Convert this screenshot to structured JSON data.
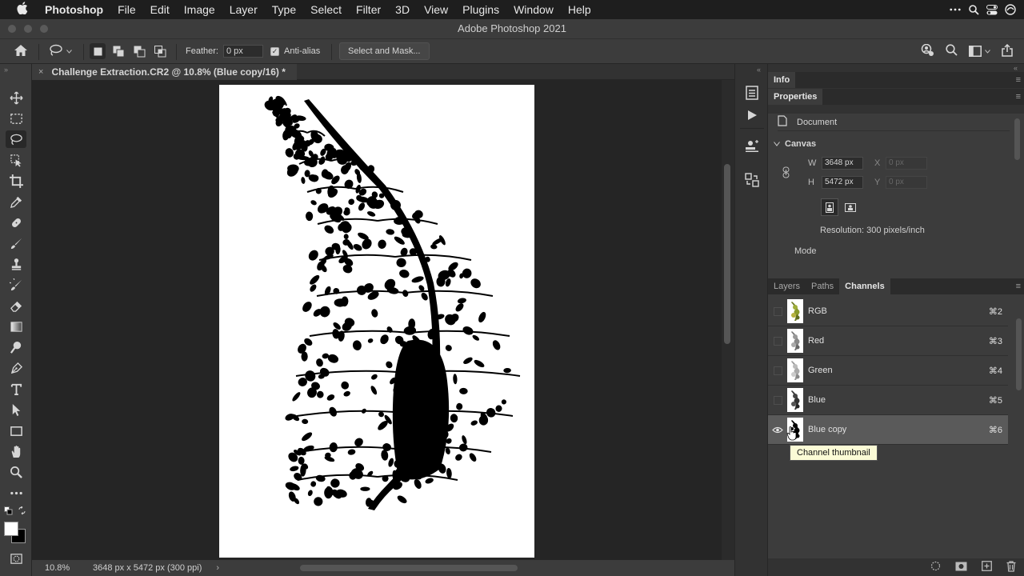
{
  "menubar": {
    "app_name": "Photoshop",
    "items": [
      "File",
      "Edit",
      "Image",
      "Layer",
      "Type",
      "Select",
      "Filter",
      "3D",
      "View",
      "Plugins",
      "Window",
      "Help"
    ],
    "status_icons": [
      "more-icon",
      "spotlight-icon",
      "control-center-icon",
      "siri-icon"
    ]
  },
  "window": {
    "title": "Adobe Photoshop 2021"
  },
  "options_bar": {
    "home_icon": "home-icon",
    "tool_icon": "lasso-icon",
    "feather_label": "Feather:",
    "feather_value": "0 px",
    "anti_alias_label": "Anti-alias",
    "anti_alias_checked": true,
    "select_mask_label": "Select and Mask...",
    "right_icons": [
      "share-user-icon",
      "search-icon",
      "workspace-icon",
      "share-icon"
    ]
  },
  "toolbar": {
    "tools": [
      "move",
      "marquee",
      "lasso",
      "object-selection",
      "crop",
      "eyedropper",
      "healing",
      "brush",
      "clone-stamp",
      "history-brush",
      "eraser",
      "gradient",
      "dodge",
      "pen",
      "type",
      "path-selection",
      "rectangle",
      "hand",
      "zoom",
      "more"
    ],
    "active_tool": "lasso",
    "foreground_color": "#ffffff",
    "background_color": "#000000"
  },
  "document": {
    "tab_title": "Challenge Extraction.CR2 @ 10.8% (Blue copy/16) *",
    "close_glyph": "×",
    "zoom": "10.8%",
    "doc_info": "3648 px x 5472 px (300 ppi)",
    "chevron": "›"
  },
  "panels": {
    "info_tab": "Info",
    "properties_tab": "Properties",
    "properties": {
      "document_label": "Document",
      "canvas_label": "Canvas",
      "w_label": "W",
      "w_value": "3648 px",
      "h_label": "H",
      "h_value": "5472 px",
      "x_label": "X",
      "x_placeholder": "0 px",
      "y_label": "Y",
      "y_placeholder": "0 px",
      "resolution": "Resolution: 300 pixels/inch",
      "mode_label": "Mode"
    },
    "channel_tabs": [
      "Layers",
      "Paths",
      "Channels"
    ],
    "active_channel_tab": "Channels",
    "channels": [
      {
        "name": "RGB",
        "shortcut": "⌘2",
        "visible": false,
        "selected": false
      },
      {
        "name": "Red",
        "shortcut": "⌘3",
        "visible": false,
        "selected": false
      },
      {
        "name": "Green",
        "shortcut": "⌘4",
        "visible": false,
        "selected": false
      },
      {
        "name": "Blue",
        "shortcut": "⌘5",
        "visible": false,
        "selected": false
      },
      {
        "name": "Blue copy",
        "shortcut": "⌘6",
        "visible": true,
        "selected": true
      }
    ],
    "tooltip": "Channel thumbnail",
    "footer_icons": [
      "load-selection-icon",
      "save-selection-icon",
      "new-channel-icon",
      "delete-icon"
    ]
  },
  "colors": {
    "accent_selected_row": "#5a5a5a",
    "panel_bg": "#3c3c3c",
    "canvas_bg": "#252525"
  }
}
